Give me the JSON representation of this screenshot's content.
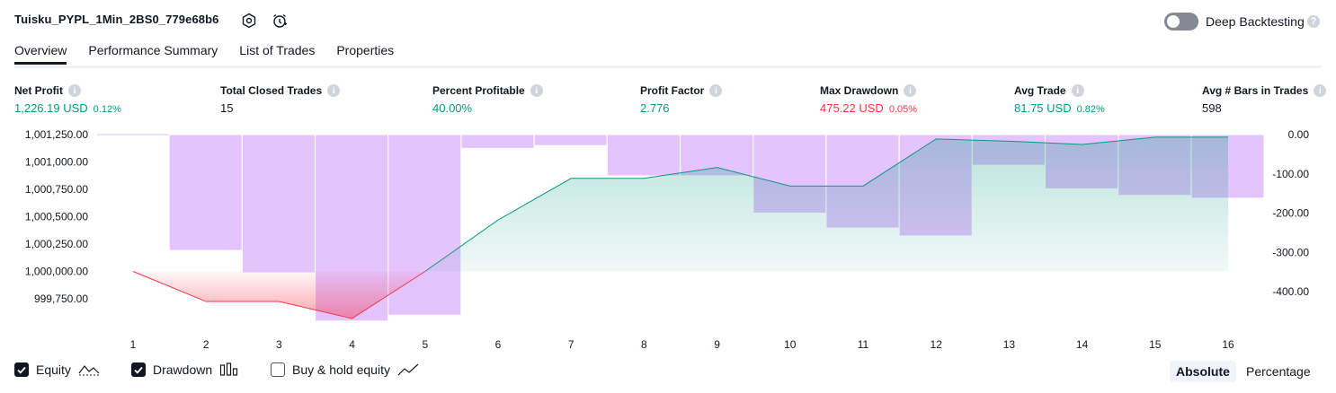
{
  "header": {
    "strategy_title": "Tuisku_PYPL_1Min_2BS0_779e68b6",
    "deep_backtesting_label": "Deep Backtesting",
    "deep_backtesting_on": false,
    "help_glyph": "?"
  },
  "tabs": [
    {
      "label": "Overview",
      "active": true
    },
    {
      "label": "Performance Summary",
      "active": false
    },
    {
      "label": "List of Trades",
      "active": false
    },
    {
      "label": "Properties",
      "active": false
    }
  ],
  "stats": [
    {
      "label": "Net Profit",
      "value": "1,226.19 USD",
      "pct": "0.12%",
      "tone": "green"
    },
    {
      "label": "Total Closed Trades",
      "value": "15",
      "pct": "",
      "tone": "neutral"
    },
    {
      "label": "Percent Profitable",
      "value": "40.00%",
      "pct": "",
      "tone": "green"
    },
    {
      "label": "Profit Factor",
      "value": "2.776",
      "pct": "",
      "tone": "green"
    },
    {
      "label": "Max Drawdown",
      "value": "475.22 USD",
      "pct": "0.05%",
      "tone": "red"
    },
    {
      "label": "Avg Trade",
      "value": "81.75 USD",
      "pct": "0.82%",
      "tone": "green"
    },
    {
      "label": "Avg # Bars in Trades",
      "value": "598",
      "pct": "",
      "tone": "neutral"
    }
  ],
  "chart_data": {
    "type": "line",
    "x": [
      1,
      2,
      3,
      4,
      5,
      6,
      7,
      8,
      9,
      10,
      11,
      12,
      13,
      14,
      15,
      16
    ],
    "left_axis_ticks": [
      "1,001,250.00",
      "1,001,000.00",
      "1,000,750.00",
      "1,000,500.00",
      "1,000,250.00",
      "1,000,000.00",
      "999,750.00"
    ],
    "left_ylim": [
      999750,
      1001250
    ],
    "right_axis_ticks": [
      "0.00",
      "-100.00",
      "-200.00",
      "-300.00",
      "-400.00"
    ],
    "right_ylim": [
      -400,
      0
    ],
    "baseline": 1000000,
    "equity": [
      1000000,
      999725,
      999725,
      999570,
      1000000,
      1000470,
      1000850,
      1000850,
      1000950,
      1000780,
      1000780,
      1001210,
      1001190,
      1001160,
      1001226,
      1001226
    ],
    "drawdown": [
      0,
      -295,
      -352,
      -475,
      -460,
      -35,
      -28,
      -105,
      -105,
      -200,
      -238,
      -258,
      -78,
      -138,
      -155,
      -162
    ],
    "colors": {
      "equity_up": "#089981",
      "equity_down": "#f23645",
      "drawdown": "#c57bfa"
    }
  },
  "legend": [
    {
      "label": "Equity",
      "checked": true,
      "icon": "equity-line-icon"
    },
    {
      "label": "Drawdown",
      "checked": true,
      "icon": "drawdown-bars-icon"
    },
    {
      "label": "Buy & hold equity",
      "checked": false,
      "icon": "buy-hold-line-icon"
    }
  ],
  "mode_toggle": {
    "absolute_label": "Absolute",
    "percentage_label": "Percentage",
    "selected": "Absolute"
  }
}
